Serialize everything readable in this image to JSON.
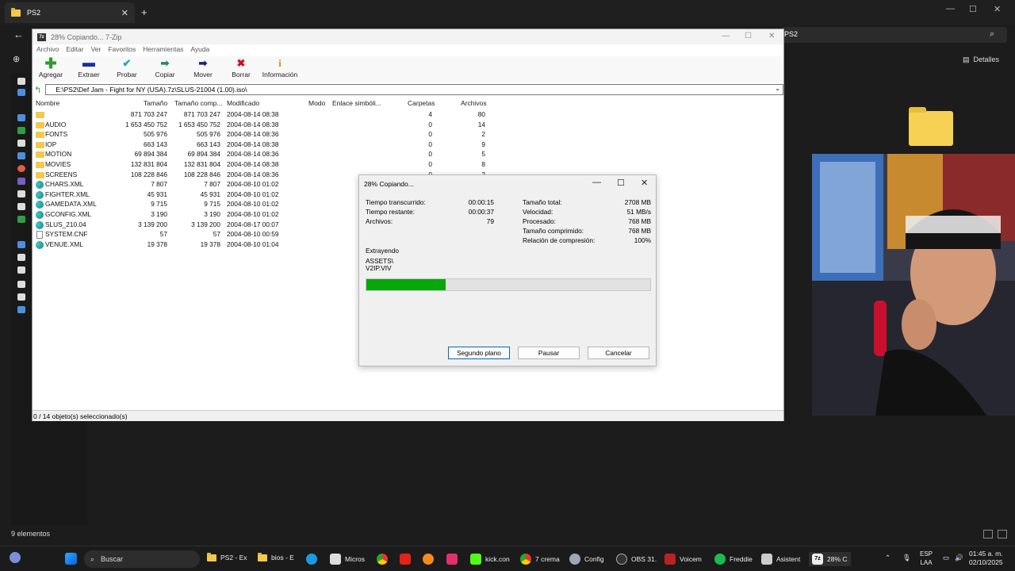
{
  "explorer": {
    "tab_title": "PS2",
    "address": "PS2",
    "details_label": "Detalles",
    "status": "9 elementos"
  },
  "zip_window": {
    "title": "28% Copiando... 7-Zip",
    "menu": [
      "Archivo",
      "Editar",
      "Ver",
      "Favoritos",
      "Herramientas",
      "Ayuda"
    ],
    "toolbar": [
      {
        "label": "Agregar",
        "icon": "add-icon"
      },
      {
        "label": "Extraer",
        "icon": "extract-icon"
      },
      {
        "label": "Probar",
        "icon": "test-icon"
      },
      {
        "label": "Copiar",
        "icon": "copy-icon"
      },
      {
        "label": "Mover",
        "icon": "move-icon"
      },
      {
        "label": "Borrar",
        "icon": "delete-icon"
      },
      {
        "label": "Información",
        "icon": "info-icon"
      }
    ],
    "path": "E:\\PS2\\Def Jam - Fight for NY (USA).7z\\SLUS-21004 (1.00).iso\\",
    "columns": [
      "Nombre",
      "Tamaño",
      "Tamaño comp...",
      "Modificado",
      "Modo",
      "Enlace simbóli...",
      "Carpetas",
      "Archivos"
    ],
    "files": [
      {
        "name": "",
        "type": "folder",
        "size": "871 703 247",
        "packed": "871 703 247",
        "modified": "2004-08-14 08:38",
        "folders": "4",
        "files": "80"
      },
      {
        "name": "AUDIO",
        "type": "folder",
        "size": "1 653 450 752",
        "packed": "1 653 450 752",
        "modified": "2004-08-14 08:38",
        "folders": "0",
        "files": "14"
      },
      {
        "name": "FONTS",
        "type": "folder",
        "size": "505 976",
        "packed": "505 976",
        "modified": "2004-08-14 08:36",
        "folders": "0",
        "files": "2"
      },
      {
        "name": "IOP",
        "type": "folder",
        "size": "663 143",
        "packed": "663 143",
        "modified": "2004-08-14 08:38",
        "folders": "0",
        "files": "9"
      },
      {
        "name": "MOTION",
        "type": "folder",
        "size": "69 894 384",
        "packed": "69 894 384",
        "modified": "2004-08-14 08:36",
        "folders": "0",
        "files": "5"
      },
      {
        "name": "MOVIES",
        "type": "folder",
        "size": "132 831 804",
        "packed": "132 831 804",
        "modified": "2004-08-14 08:38",
        "folders": "0",
        "files": "8"
      },
      {
        "name": "SCREENS",
        "type": "folder",
        "size": "108 228 846",
        "packed": "108 228 846",
        "modified": "2004-08-14 08:36",
        "folders": "0",
        "files": "2"
      },
      {
        "name": "CHARS.XML",
        "type": "edge",
        "size": "7 807",
        "packed": "7 807",
        "modified": "2004-08-10 01:02",
        "folders": "",
        "files": ""
      },
      {
        "name": "FIGHTER.XML",
        "type": "edge",
        "size": "45 931",
        "packed": "45 931",
        "modified": "2004-08-10 01:02",
        "folders": "",
        "files": ""
      },
      {
        "name": "GAMEDATA.XML",
        "type": "edge",
        "size": "9 715",
        "packed": "9 715",
        "modified": "2004-08-10 01:02",
        "folders": "",
        "files": ""
      },
      {
        "name": "GCONFIG.XML",
        "type": "edge",
        "size": "3 190",
        "packed": "3 190",
        "modified": "2004-08-10 01:02",
        "folders": "",
        "files": ""
      },
      {
        "name": "SLUS_210.04",
        "type": "edge",
        "size": "3 139 200",
        "packed": "3 139 200",
        "modified": "2004-08-17 00:07",
        "folders": "",
        "files": ""
      },
      {
        "name": "SYSTEM.CNF",
        "type": "doc",
        "size": "57",
        "packed": "57",
        "modified": "2004-08-10 00:59",
        "folders": "",
        "files": ""
      },
      {
        "name": "VENUE.XML",
        "type": "edge",
        "size": "19 378",
        "packed": "19 378",
        "modified": "2004-08-10 01:04",
        "folders": "",
        "files": ""
      }
    ],
    "status": "0 / 14 objeto(s) seleccionado(s)"
  },
  "copy_dialog": {
    "title": "28% Copiando...",
    "left_stats": [
      {
        "label": "Tiempo transcurrido:",
        "value": "00:00:15"
      },
      {
        "label": "Tiempo restante:",
        "value": "00:00:37"
      },
      {
        "label": "Archivos:",
        "value": "79"
      }
    ],
    "right_stats": [
      {
        "label": "Tamaño total:",
        "value": "2708 MB"
      },
      {
        "label": "Velocidad:",
        "value": "51 MB/s"
      },
      {
        "label": "Procesado:",
        "value": "768 MB"
      },
      {
        "label": "Tamaño comprimido:",
        "value": "768 MB"
      },
      {
        "label": "Relación de compresión:",
        "value": "100%"
      }
    ],
    "operation": "Extrayendo",
    "current_folder": "ASSETS\\",
    "current_file": "V2IP.VIV",
    "progress_fraction": 0.28,
    "buttons": {
      "background": "Segundo plano",
      "pause": "Pausar",
      "cancel": "Cancelar"
    }
  },
  "taskbar": {
    "search_label": "Buscar",
    "apps": [
      "PS2 - Ex",
      "bios - E",
      "Micros",
      "kick.con",
      "7 crema",
      "Config",
      "OBS 31.",
      "Voicem",
      "Freddie",
      "Asistent",
      "28% C"
    ],
    "lang_top": "ESP",
    "lang_bottom": "LAA",
    "time": "01:45 a. m.",
    "date": "02/10/2025"
  }
}
